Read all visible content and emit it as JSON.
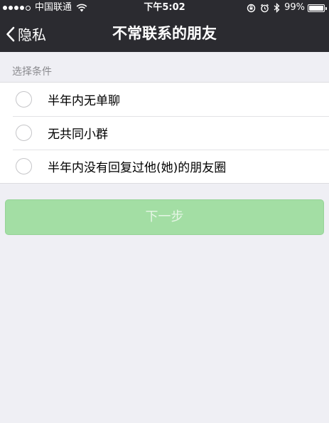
{
  "status_bar": {
    "carrier": "中国联通",
    "time": "下午5:02",
    "battery": "99%",
    "battery_level": 0.99
  },
  "nav": {
    "back_label": "隐私",
    "title": "不常联系的朋友"
  },
  "section": {
    "header": "选择条件"
  },
  "options": [
    {
      "label": "半年内无单聊",
      "selected": false
    },
    {
      "label": "无共同小群",
      "selected": false
    },
    {
      "label": "半年内没有回复过他(她)的朋友圈",
      "selected": false
    }
  ],
  "next_button": {
    "label": "下一步",
    "enabled": false
  },
  "colors": {
    "nav_background": "#2b2b30",
    "page_background": "#efeff4",
    "button_disabled_green": "#a3dea4"
  }
}
